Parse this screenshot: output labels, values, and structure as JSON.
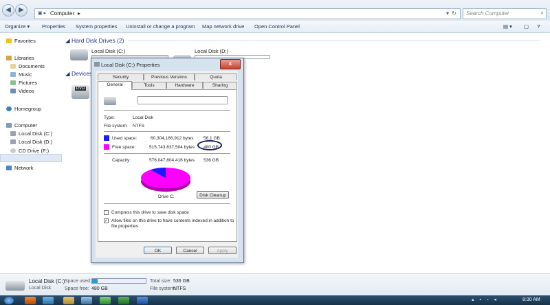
{
  "address": {
    "location": "Computer",
    "search_placeholder": "Search Computer"
  },
  "toolbar": {
    "organize": "Organize ▾",
    "properties": "Properties",
    "system_properties": "System properties",
    "uninstall": "Uninstall or change a program",
    "map_drive": "Map network drive",
    "control_panel": "Open Control Panel"
  },
  "nav": {
    "favorites": "Favorites",
    "libraries": "Libraries",
    "documents": "Documents",
    "music": "Music",
    "pictures": "Pictures",
    "videos": "Videos",
    "homegroup": "Homegroup",
    "computer": "Computer",
    "local_c": "Local Disk (C:)",
    "local_d": "Local Disk (D:)",
    "cd_drive": "CD Drive (F:)",
    "network": "Network"
  },
  "content": {
    "hdd_group": "Hard Disk Drives (2)",
    "devices_group": "Devices",
    "drive_c": "Local Disk (C:)",
    "drive_d": "Local Disk (D:)",
    "dvd_label": "DVD"
  },
  "dialog": {
    "title": "Local Disk (C:) Properties",
    "close": "x",
    "tabs": {
      "security": "Security",
      "previous_versions": "Previous Versions",
      "quota": "Quota",
      "general": "General",
      "tools": "Tools",
      "hardware": "Hardware",
      "sharing": "Sharing"
    },
    "type_label": "Type:",
    "type_value": "Local Disk",
    "fs_label": "File system:",
    "fs_value": "NTFS",
    "used_label": "Used space:",
    "used_bytes": "60,304,166,912 bytes",
    "used_gb": "56.1 GB",
    "free_label": "Free space:",
    "free_bytes": "515,743,637,504 bytes",
    "free_gb": "480 GB",
    "capacity_label": "Capacity:",
    "capacity_bytes": "576,047,804,416 bytes",
    "capacity_gb": "536 GB",
    "drive_label": "Drive C:",
    "disk_cleanup": "Disk Cleanup",
    "compress": "Compress this drive to save disk space",
    "index": "Allow files on this drive to have contents indexed in addition to file properties",
    "ok": "OK",
    "cancel": "Cancel",
    "apply": "Apply",
    "used_fraction": 0.105,
    "used_color": "#1a1aff",
    "free_color": "#ff00ff"
  },
  "status": {
    "name": "Local Disk (C:)",
    "type": "Local Disk",
    "space_used_label": "Space used:",
    "space_free_label": "Space free:",
    "space_free_value": "480 GB",
    "total_size_label": "Total size:",
    "total_size_value": "536 GB",
    "fs_label": "File system:",
    "fs_value": "NTFS",
    "used_fraction": 0.105
  },
  "taskbar": {
    "time": "8:30 AM"
  }
}
